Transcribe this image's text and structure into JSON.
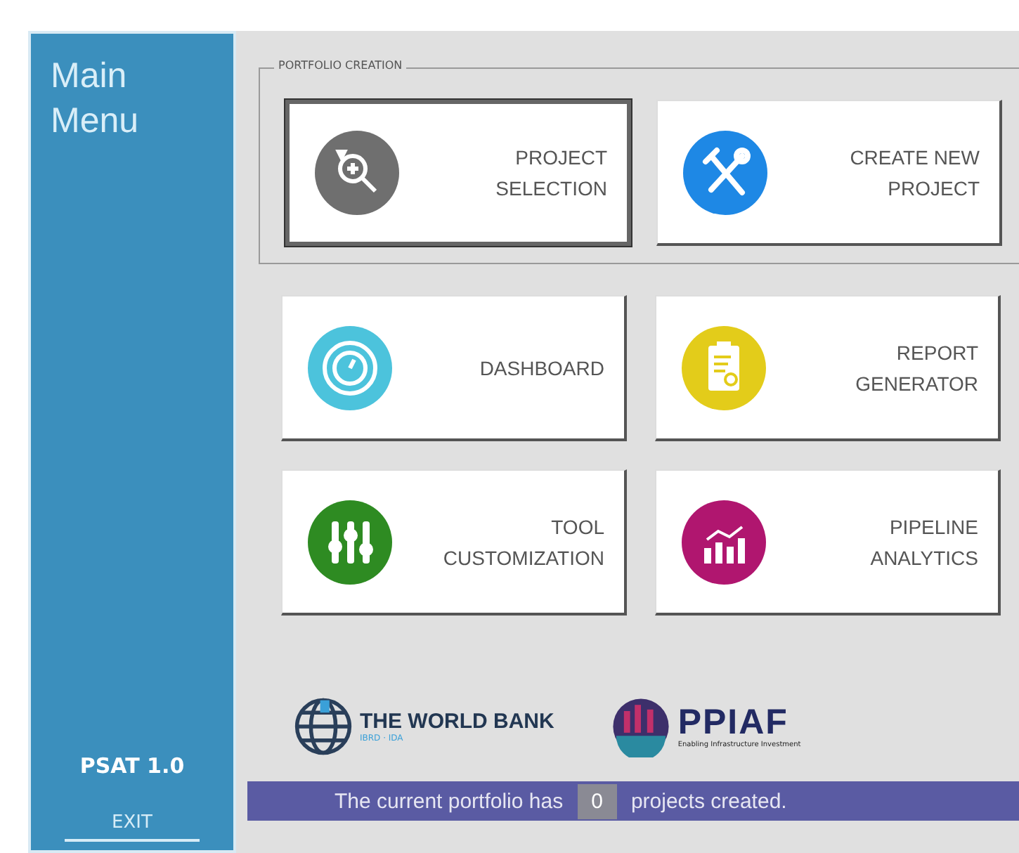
{
  "sidebar": {
    "title_lines": [
      "Main",
      "Menu"
    ],
    "version": "PSAT 1.0",
    "exit": "EXIT"
  },
  "portfolio_creation": {
    "legend": "PORTFOLIO CREATION",
    "buttons": [
      {
        "kind": "search",
        "color": "#6f6f6f",
        "lines": [
          "PROJECT",
          "SELECTION"
        ],
        "selected": true
      },
      {
        "kind": "tools",
        "color": "#1e88e5",
        "lines": [
          "CREATE NEW",
          "PROJECT"
        ],
        "selected": false
      }
    ]
  },
  "button_rows": [
    {
      "buttons": [
        {
          "kind": "gauge",
          "color": "#4cc3dc",
          "lines": [
            "DASHBOARD"
          ],
          "selected": false
        },
        {
          "kind": "report",
          "color": "#e3cc1a",
          "lines": [
            "REPORT",
            "GENERATOR"
          ],
          "selected": false
        }
      ]
    },
    {
      "buttons": [
        {
          "kind": "sliders",
          "color": "#2e8b22",
          "lines": [
            "TOOL",
            "CUSTOMIZATION"
          ],
          "selected": false
        },
        {
          "kind": "chart",
          "color": "#b0166f",
          "lines": [
            "PIPELINE",
            "ANALYTICS"
          ],
          "selected": false
        }
      ]
    }
  ],
  "logos": {
    "world_bank": {
      "name": "THE WORLD BANK",
      "sub": "IBRD · IDA"
    },
    "ppiaf": {
      "name": "PPIAF",
      "sub": "Enabling Infrastructure Investment"
    }
  },
  "status_bar": {
    "before": "The current portfolio has",
    "count": "0",
    "after": "projects created."
  }
}
